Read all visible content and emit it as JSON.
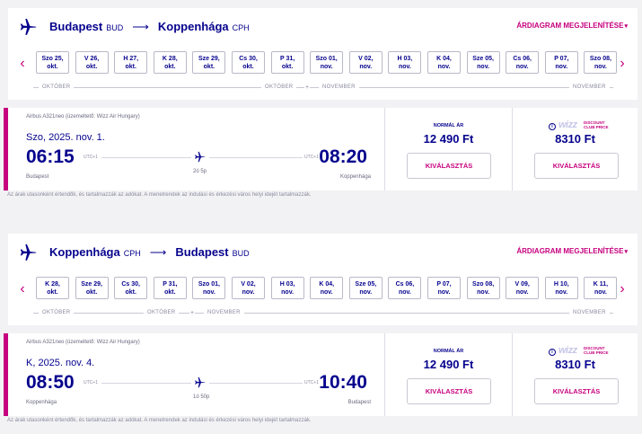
{
  "sections": [
    {
      "from_city": "Budapest",
      "from_code": "BUD",
      "to_city": "Koppenhága",
      "to_code": "CPH",
      "price_chart_label": "Árdiagram megjelenítése",
      "dates": [
        {
          "day": "Szo 25,",
          "month": "okt."
        },
        {
          "day": "V 26,",
          "month": "okt."
        },
        {
          "day": "H 27,",
          "month": "okt."
        },
        {
          "day": "K 28,",
          "month": "okt."
        },
        {
          "day": "Sze 29,",
          "month": "okt."
        },
        {
          "day": "Cs 30,",
          "month": "okt."
        },
        {
          "day": "P 31,",
          "month": "okt."
        },
        {
          "day": "Szo 01,",
          "month": "nov."
        },
        {
          "day": "V 02,",
          "month": "nov."
        },
        {
          "day": "H 03,",
          "month": "nov."
        },
        {
          "day": "K 04,",
          "month": "nov."
        },
        {
          "day": "Sze 05,",
          "month": "nov."
        },
        {
          "day": "Cs 06,",
          "month": "nov."
        },
        {
          "day": "P 07,",
          "month": "nov."
        },
        {
          "day": "Szo 08,",
          "month": "nov."
        }
      ],
      "month_labels": [
        "Október",
        "Október",
        "November",
        "November"
      ],
      "flight": {
        "aircraft": "Airbus A321neo (üzemeltető: Wizz Air Hungary)",
        "date": "Szo, 2025. nov. 1.",
        "dep_time": "06:15",
        "arr_time": "08:20",
        "dep_utc": "UTC+1",
        "arr_utc": "UTC+1",
        "duration": "2ó 5p",
        "dep_city": "Budapest",
        "arr_city": "Koppenhága",
        "normal_label": "Normál ár",
        "normal_price": "12 490 Ft",
        "club_price": "8310 Ft",
        "select_label": "Kiválasztás"
      },
      "footnote": "Az árak utasonként értendők, és tartalmazzák az adókat. A menetrendek az indulási és érkezési város helyi idejét tartalmazzák."
    },
    {
      "from_city": "Koppenhága",
      "from_code": "CPH",
      "to_city": "Budapest",
      "to_code": "BUD",
      "price_chart_label": "Árdiagram megjelenítése",
      "dates": [
        {
          "day": "K 28,",
          "month": "okt."
        },
        {
          "day": "Sze 29,",
          "month": "okt."
        },
        {
          "day": "Cs 30,",
          "month": "okt."
        },
        {
          "day": "P 31,",
          "month": "okt."
        },
        {
          "day": "Szo 01,",
          "month": "nov."
        },
        {
          "day": "V 02,",
          "month": "nov."
        },
        {
          "day": "H 03,",
          "month": "nov."
        },
        {
          "day": "K 04,",
          "month": "nov."
        },
        {
          "day": "Sze 05,",
          "month": "nov."
        },
        {
          "day": "Cs 06,",
          "month": "nov."
        },
        {
          "day": "P 07,",
          "month": "nov."
        },
        {
          "day": "Szo 08,",
          "month": "nov."
        },
        {
          "day": "V 09,",
          "month": "nov."
        },
        {
          "day": "H 10,",
          "month": "nov."
        },
        {
          "day": "K 11,",
          "month": "nov."
        }
      ],
      "month_labels": [
        "Október",
        "Október",
        "November",
        "November"
      ],
      "flight": {
        "aircraft": "Airbus A321neo (üzemeltető: Wizz Air Hungary)",
        "date": "K, 2025. nov. 4.",
        "dep_time": "08:50",
        "arr_time": "10:40",
        "dep_utc": "UTC+1",
        "arr_utc": "UTC+1",
        "duration": "1ó 50p",
        "dep_city": "Koppenhága",
        "arr_city": "Budapest",
        "normal_label": "Normál ár",
        "normal_price": "12 490 Ft",
        "club_price": "8310 Ft",
        "select_label": "Kiválasztás"
      },
      "footnote": "Az árak utasonként értendők, és tartalmazzák az adókat. A menetrendek az indulási és érkezési város helyi idejét tartalmazzák."
    }
  ],
  "club_badge": {
    "brand": "wizz",
    "line1": "Discount",
    "line2": "Club price",
    "info": "i"
  },
  "icons": {
    "logo": "plane-logo-icon",
    "left": "chevron-left-icon",
    "right": "chevron-right-icon",
    "flight": "airplane-icon"
  },
  "colors": {
    "navy": "#06038d",
    "magenta": "#c6007e"
  }
}
